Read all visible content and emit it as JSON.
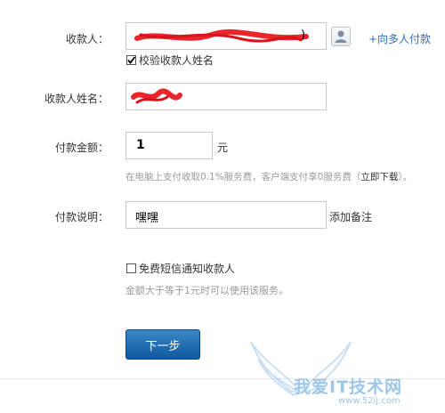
{
  "payee": {
    "label": "收款人：",
    "contact_icon": "contact-person-icon",
    "multi_payee_link": "+向多人付款",
    "verify_label": "校验收款人姓名",
    "verify_checked": true
  },
  "payee_name": {
    "label": "收款人姓名："
  },
  "amount": {
    "label": "付款金额：",
    "value": "1",
    "unit": "元",
    "hint_prefix": "在电脑上支付收取0.1%服务费，客户端支付享0服务费（",
    "hint_link": "立即下载",
    "hint_suffix": "）。"
  },
  "note": {
    "label": "付款说明：",
    "value": "嘿嘿",
    "add_note": "添加备注"
  },
  "sms": {
    "label": "免费短信通知收款人",
    "checked": false,
    "hint": "金额大于等于1元时可以使用该服务。"
  },
  "next_button": "下一步",
  "watermark": {
    "text": "我爱IT技术网",
    "url": "www.52ij.com"
  },
  "colors": {
    "link": "#2f6fb2",
    "button": "#1566ad",
    "redaction": "#e8262b"
  }
}
